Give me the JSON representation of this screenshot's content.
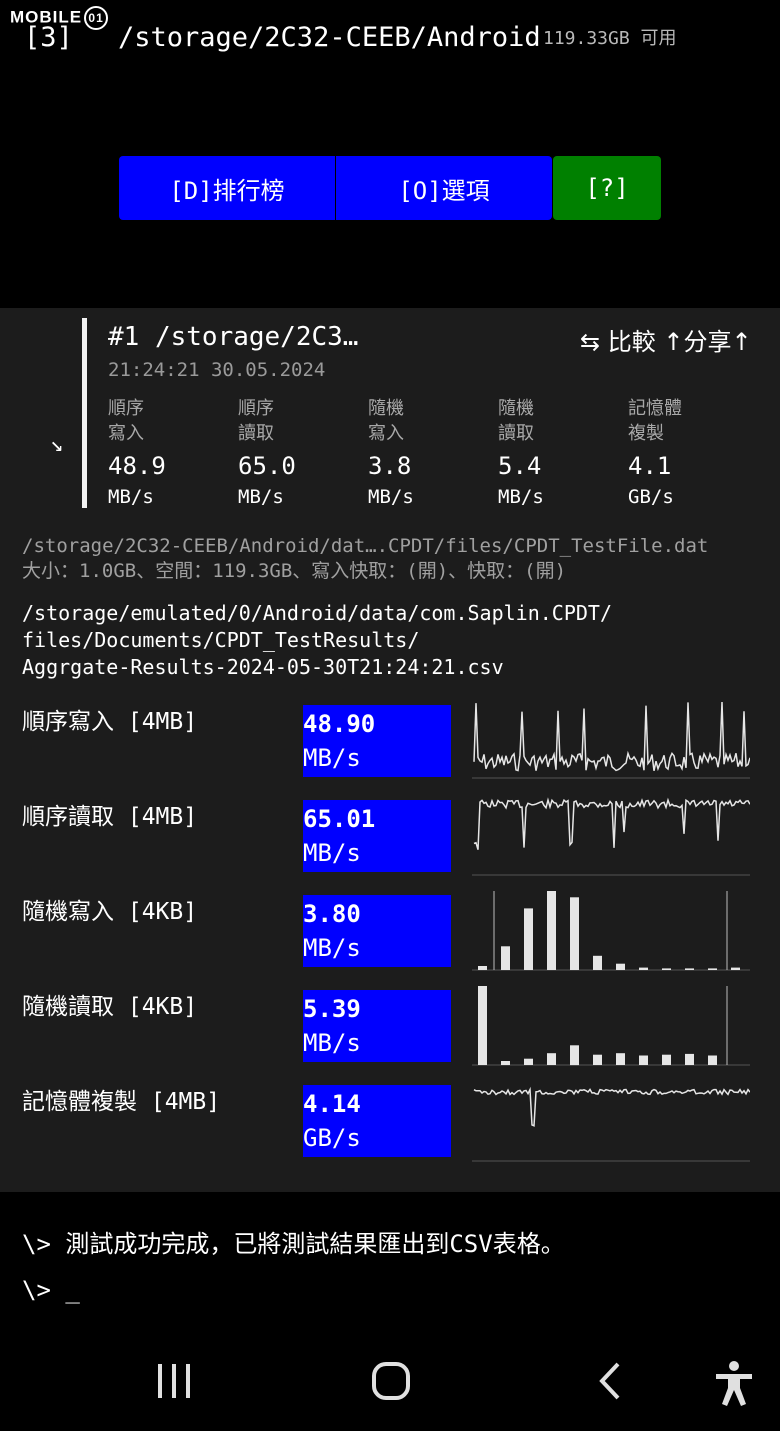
{
  "watermark": {
    "text": "MOBILE",
    "mark": "01"
  },
  "header": {
    "drive_index": "[3]",
    "drive_path": "/storage/2C32-CEEB/Android",
    "free_space": "119.33GB 可用"
  },
  "buttons": {
    "rank": "[D]排行榜",
    "options": "[O]選項",
    "help": "[?]"
  },
  "result": {
    "title": "#1 /storage/2C3…",
    "compare_label": "⇆ 比較 ↑分享↑",
    "timestamp": "21:24:21 30.05.2024",
    "collapse_icon": "↘",
    "metrics": [
      {
        "label1": "順序",
        "label2": "寫入",
        "value": "48.9",
        "unit": "MB/s"
      },
      {
        "label1": "順序",
        "label2": "讀取",
        "value": "65.0",
        "unit": "MB/s"
      },
      {
        "label1": "隨機",
        "label2": "寫入",
        "value": "3.8",
        "unit": "MB/s"
      },
      {
        "label1": "隨機",
        "label2": "讀取",
        "value": "5.4",
        "unit": "MB/s"
      },
      {
        "label1": "記憶體",
        "label2": "複製",
        "value": "4.1",
        "unit": "GB/s"
      }
    ]
  },
  "file_info": {
    "path": "/storage/2C32-CEEB/Android/dat….CPDT/files/CPDT_TestFile.dat",
    "details": "大小：1.0GB、空間：119.3GB、寫入快取：(開)、快取：(開)"
  },
  "csv": {
    "line1": "/storage/emulated/0/Android/data/com.Saplin.CPDT/",
    "line2": "files/Documents/CPDT_TestResults/",
    "line3": "Aggrgate-Results-2024-05-30T21:24:21.csv"
  },
  "tests": [
    {
      "label": "順序寫入 [4MB]",
      "value": "48.90",
      "unit": "MB/s"
    },
    {
      "label": "順序讀取 [4MB]",
      "value": "65.01",
      "unit": "MB/s"
    },
    {
      "label": "隨機寫入 [4KB]",
      "value": "3.80",
      "unit": "MB/s"
    },
    {
      "label": "隨機讀取 [4KB]",
      "value": "5.39",
      "unit": "MB/s"
    },
    {
      "label": "記憶體複製 [4MB]",
      "value": "4.14",
      "unit": "GB/s"
    }
  ],
  "histograms": {
    "random_write": [
      0.05,
      0.3,
      0.78,
      1.0,
      0.92,
      0.18,
      0.08,
      0.03,
      0.02,
      0.02,
      0.02,
      0.03
    ],
    "random_read": [
      1.0,
      0.05,
      0.08,
      0.15,
      0.25,
      0.13,
      0.15,
      0.12,
      0.13,
      0.14,
      0.12,
      0.0
    ]
  },
  "console": {
    "line1": "\\> 測試成功完成，已將測試結果匯出到CSV表格。",
    "line2": "\\> _"
  },
  "navbar": {
    "recents": "recents-icon",
    "home": "home-icon",
    "back": "back-icon",
    "accessibility": "accessibility-icon"
  }
}
